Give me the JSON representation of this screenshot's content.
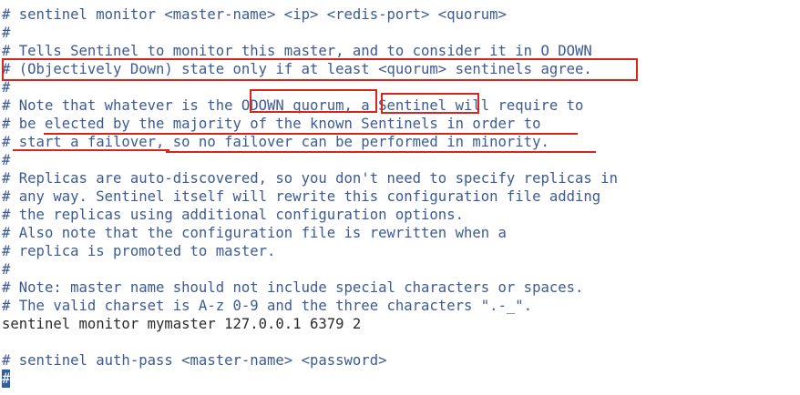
{
  "editor": {
    "lines": [
      {
        "text": "# sentinel monitor <master-name> <ip> <redis-port> <quorum>",
        "kind": "comment"
      },
      {
        "text": "#",
        "kind": "comment"
      },
      {
        "text": "# Tells Sentinel to monitor this master, and to consider it in O_DOWN",
        "kind": "comment"
      },
      {
        "text": "# (Objectively Down) state only if at least <quorum> sentinels agree.",
        "kind": "comment"
      },
      {
        "text": "#",
        "kind": "comment"
      },
      {
        "text": "# Note that whatever is the ODOWN quorum, a Sentinel will require to",
        "kind": "comment"
      },
      {
        "text": "# be elected by the majority of the known Sentinels in order to",
        "kind": "comment"
      },
      {
        "text": "# start a failover, so no failover can be performed in minority.",
        "kind": "comment"
      },
      {
        "text": "#",
        "kind": "comment"
      },
      {
        "text": "# Replicas are auto-discovered, so you don't need to specify replicas in",
        "kind": "comment"
      },
      {
        "text": "# any way. Sentinel itself will rewrite this configuration file adding",
        "kind": "comment"
      },
      {
        "text": "# the replicas using additional configuration options.",
        "kind": "comment"
      },
      {
        "text": "# Also note that the configuration file is rewritten when a",
        "kind": "comment"
      },
      {
        "text": "# replica is promoted to master.",
        "kind": "comment"
      },
      {
        "text": "#",
        "kind": "comment"
      },
      {
        "text": "# Note: master name should not include special characters or spaces.",
        "kind": "comment"
      },
      {
        "text": "# The valid charset is A-z 0-9 and the three characters \".-_\".",
        "kind": "comment"
      },
      {
        "text": "sentinel monitor mymaster 127.0.0.1 6379 2",
        "kind": "code"
      },
      {
        "text": "",
        "kind": "code"
      },
      {
        "text": "# sentinel auth-pass <master-name> <password>",
        "kind": "comment"
      },
      {
        "text": "#",
        "kind": "comment",
        "cursor": true
      }
    ]
  },
  "annotations": {
    "color": "#d9261c"
  }
}
